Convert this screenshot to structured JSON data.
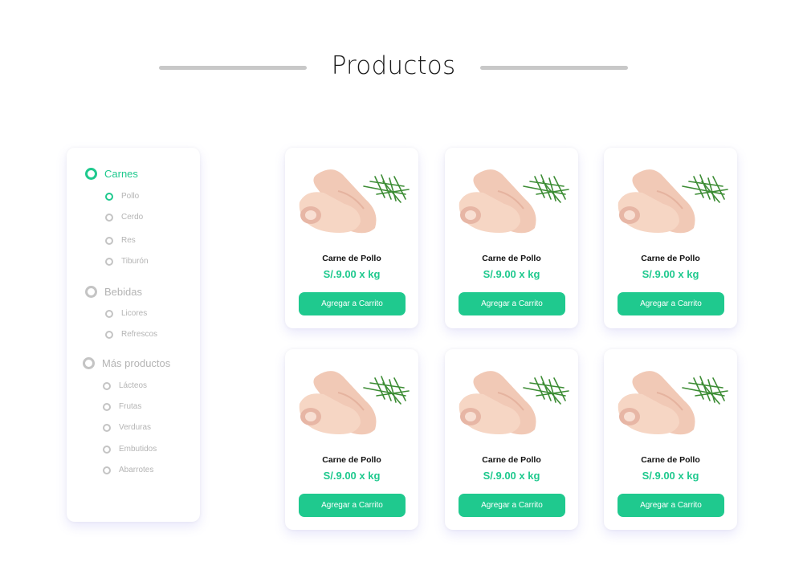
{
  "page": {
    "title": "Productos"
  },
  "sidebar": {
    "categories": [
      {
        "label": "Carnes",
        "items": [
          "Pollo",
          "Cerdo",
          "Res",
          "Tiburón"
        ]
      },
      {
        "label": "Bebidas",
        "items": [
          "Licores",
          "Refrescos"
        ]
      },
      {
        "label": "Más productos",
        "items": [
          "Lácteos",
          "Frutas",
          "Verduras",
          "Embutidos",
          "Abarrotes"
        ]
      }
    ],
    "selected_category": "Carnes",
    "selected_item": "Pollo"
  },
  "products": [
    {
      "name": "Carne de Pollo",
      "price": "S/.9.00 x kg",
      "button": "Agregar a Carrito",
      "image_icon": "chicken-drumsticks-image"
    },
    {
      "name": "Carne de Pollo",
      "price": "S/.9.00 x kg",
      "button": "Agregar a Carrito",
      "image_icon": "chicken-drumsticks-image"
    },
    {
      "name": "Carne de Pollo",
      "price": "S/.9.00 x kg",
      "button": "Agregar a Carrito",
      "image_icon": "chicken-drumsticks-image"
    },
    {
      "name": "Carne de Pollo",
      "price": "S/.9.00 x kg",
      "button": "Agregar a Carrito",
      "image_icon": "chicken-drumsticks-image"
    },
    {
      "name": "Carne de Pollo",
      "price": "S/.9.00 x kg",
      "button": "Agregar a Carrito",
      "image_icon": "chicken-drumsticks-image"
    },
    {
      "name": "Carne de Pollo",
      "price": "S/.9.00 x kg",
      "button": "Agregar a Carrito",
      "image_icon": "chicken-drumsticks-image"
    }
  ],
  "colors": {
    "accent": "#1fc98e",
    "muted": "#b4b4b4",
    "divider": "#c8c8c8"
  }
}
